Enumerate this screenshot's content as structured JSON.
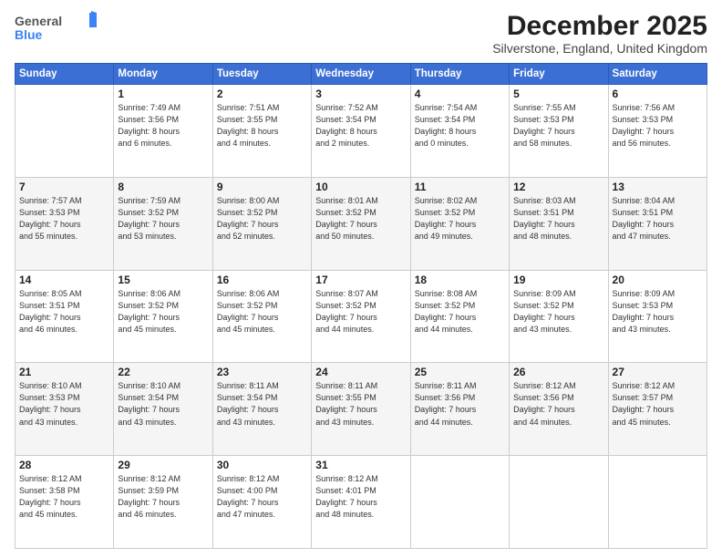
{
  "header": {
    "logo": {
      "general": "General",
      "blue": "Blue"
    },
    "title": "December 2025",
    "subtitle": "Silverstone, England, United Kingdom"
  },
  "weekdays": [
    "Sunday",
    "Monday",
    "Tuesday",
    "Wednesday",
    "Thursday",
    "Friday",
    "Saturday"
  ],
  "weeks": [
    [
      {
        "num": "",
        "detail": ""
      },
      {
        "num": "1",
        "detail": "Sunrise: 7:49 AM\nSunset: 3:56 PM\nDaylight: 8 hours\nand 6 minutes."
      },
      {
        "num": "2",
        "detail": "Sunrise: 7:51 AM\nSunset: 3:55 PM\nDaylight: 8 hours\nand 4 minutes."
      },
      {
        "num": "3",
        "detail": "Sunrise: 7:52 AM\nSunset: 3:54 PM\nDaylight: 8 hours\nand 2 minutes."
      },
      {
        "num": "4",
        "detail": "Sunrise: 7:54 AM\nSunset: 3:54 PM\nDaylight: 8 hours\nand 0 minutes."
      },
      {
        "num": "5",
        "detail": "Sunrise: 7:55 AM\nSunset: 3:53 PM\nDaylight: 7 hours\nand 58 minutes."
      },
      {
        "num": "6",
        "detail": "Sunrise: 7:56 AM\nSunset: 3:53 PM\nDaylight: 7 hours\nand 56 minutes."
      }
    ],
    [
      {
        "num": "7",
        "detail": "Sunrise: 7:57 AM\nSunset: 3:53 PM\nDaylight: 7 hours\nand 55 minutes."
      },
      {
        "num": "8",
        "detail": "Sunrise: 7:59 AM\nSunset: 3:52 PM\nDaylight: 7 hours\nand 53 minutes."
      },
      {
        "num": "9",
        "detail": "Sunrise: 8:00 AM\nSunset: 3:52 PM\nDaylight: 7 hours\nand 52 minutes."
      },
      {
        "num": "10",
        "detail": "Sunrise: 8:01 AM\nSunset: 3:52 PM\nDaylight: 7 hours\nand 50 minutes."
      },
      {
        "num": "11",
        "detail": "Sunrise: 8:02 AM\nSunset: 3:52 PM\nDaylight: 7 hours\nand 49 minutes."
      },
      {
        "num": "12",
        "detail": "Sunrise: 8:03 AM\nSunset: 3:51 PM\nDaylight: 7 hours\nand 48 minutes."
      },
      {
        "num": "13",
        "detail": "Sunrise: 8:04 AM\nSunset: 3:51 PM\nDaylight: 7 hours\nand 47 minutes."
      }
    ],
    [
      {
        "num": "14",
        "detail": "Sunrise: 8:05 AM\nSunset: 3:51 PM\nDaylight: 7 hours\nand 46 minutes."
      },
      {
        "num": "15",
        "detail": "Sunrise: 8:06 AM\nSunset: 3:52 PM\nDaylight: 7 hours\nand 45 minutes."
      },
      {
        "num": "16",
        "detail": "Sunrise: 8:06 AM\nSunset: 3:52 PM\nDaylight: 7 hours\nand 45 minutes."
      },
      {
        "num": "17",
        "detail": "Sunrise: 8:07 AM\nSunset: 3:52 PM\nDaylight: 7 hours\nand 44 minutes."
      },
      {
        "num": "18",
        "detail": "Sunrise: 8:08 AM\nSunset: 3:52 PM\nDaylight: 7 hours\nand 44 minutes."
      },
      {
        "num": "19",
        "detail": "Sunrise: 8:09 AM\nSunset: 3:52 PM\nDaylight: 7 hours\nand 43 minutes."
      },
      {
        "num": "20",
        "detail": "Sunrise: 8:09 AM\nSunset: 3:53 PM\nDaylight: 7 hours\nand 43 minutes."
      }
    ],
    [
      {
        "num": "21",
        "detail": "Sunrise: 8:10 AM\nSunset: 3:53 PM\nDaylight: 7 hours\nand 43 minutes."
      },
      {
        "num": "22",
        "detail": "Sunrise: 8:10 AM\nSunset: 3:54 PM\nDaylight: 7 hours\nand 43 minutes."
      },
      {
        "num": "23",
        "detail": "Sunrise: 8:11 AM\nSunset: 3:54 PM\nDaylight: 7 hours\nand 43 minutes."
      },
      {
        "num": "24",
        "detail": "Sunrise: 8:11 AM\nSunset: 3:55 PM\nDaylight: 7 hours\nand 43 minutes."
      },
      {
        "num": "25",
        "detail": "Sunrise: 8:11 AM\nSunset: 3:56 PM\nDaylight: 7 hours\nand 44 minutes."
      },
      {
        "num": "26",
        "detail": "Sunrise: 8:12 AM\nSunset: 3:56 PM\nDaylight: 7 hours\nand 44 minutes."
      },
      {
        "num": "27",
        "detail": "Sunrise: 8:12 AM\nSunset: 3:57 PM\nDaylight: 7 hours\nand 45 minutes."
      }
    ],
    [
      {
        "num": "28",
        "detail": "Sunrise: 8:12 AM\nSunset: 3:58 PM\nDaylight: 7 hours\nand 45 minutes."
      },
      {
        "num": "29",
        "detail": "Sunrise: 8:12 AM\nSunset: 3:59 PM\nDaylight: 7 hours\nand 46 minutes."
      },
      {
        "num": "30",
        "detail": "Sunrise: 8:12 AM\nSunset: 4:00 PM\nDaylight: 7 hours\nand 47 minutes."
      },
      {
        "num": "31",
        "detail": "Sunrise: 8:12 AM\nSunset: 4:01 PM\nDaylight: 7 hours\nand 48 minutes."
      },
      {
        "num": "",
        "detail": ""
      },
      {
        "num": "",
        "detail": ""
      },
      {
        "num": "",
        "detail": ""
      }
    ]
  ]
}
